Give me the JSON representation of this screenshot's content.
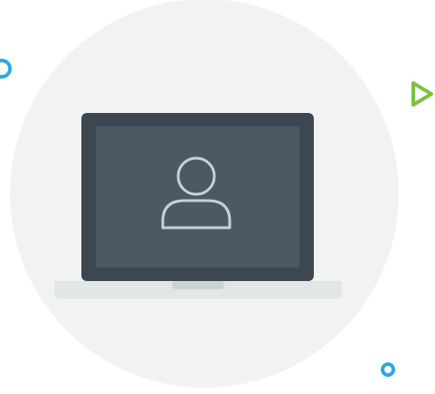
{
  "illustration": {
    "subject": "laptop-user-icon",
    "colors": {
      "background": "#ffffff",
      "backdrop_circle": "#f1f2f2",
      "laptop_frame": "#3c4752",
      "laptop_screen": "#4b5965",
      "user_icon_stroke": "#c9d0d6",
      "laptop_base": "#e3e6e7",
      "laptop_notch": "#cdd2d4",
      "accent_blue": "#29a9e0",
      "accent_green": "#7cc242"
    },
    "icons": [
      "user-icon",
      "laptop-icon",
      "ring-icon",
      "play-triangle-icon",
      "dot-ring-icon"
    ]
  }
}
